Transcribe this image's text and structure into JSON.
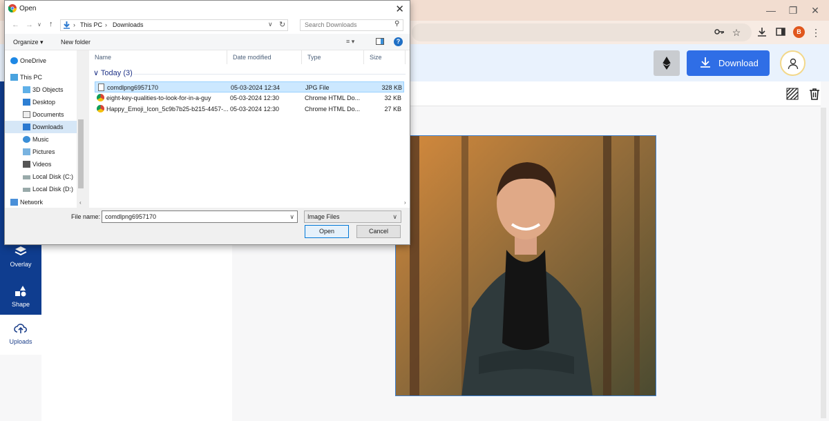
{
  "browser": {
    "profile_initial": "B"
  },
  "header": {
    "download_label": "Download"
  },
  "sidebar": {
    "items": [
      {
        "label": "Overlay",
        "icon": "layers-icon"
      },
      {
        "label": "Shape",
        "icon": "shapes-icon"
      },
      {
        "label": "Uploads",
        "icon": "cloud-upload-icon"
      }
    ]
  },
  "dialog": {
    "title": "Open",
    "breadcrumb": [
      "This PC",
      "Downloads"
    ],
    "search_placeholder": "Search Downloads",
    "organize_label": "Organize ▾",
    "new_folder_label": "New folder",
    "nav_items": [
      {
        "label": "OneDrive",
        "icon": "cloud-icon"
      },
      {
        "label": "This PC",
        "icon": "computer-icon"
      },
      {
        "label": "3D Objects",
        "icon": "cube-icon"
      },
      {
        "label": "Desktop",
        "icon": "desktop-icon"
      },
      {
        "label": "Documents",
        "icon": "document-icon"
      },
      {
        "label": "Downloads",
        "icon": "download-arrow-icon"
      },
      {
        "label": "Music",
        "icon": "music-icon"
      },
      {
        "label": "Pictures",
        "icon": "pictures-icon"
      },
      {
        "label": "Videos",
        "icon": "video-icon"
      },
      {
        "label": "Local Disk (C:)",
        "icon": "drive-icon"
      },
      {
        "label": "Local Disk (D:)",
        "icon": "drive-icon"
      },
      {
        "label": "Network",
        "icon": "network-icon"
      }
    ],
    "columns": [
      "Name",
      "Date modified",
      "Type",
      "Size"
    ],
    "group_label": "Today (3)",
    "files": [
      {
        "name": "comdlpng6957170",
        "date": "05-03-2024 12:34",
        "type": "JPG File",
        "size": "328 KB",
        "icon": "image-file-icon"
      },
      {
        "name": "eight-key-qualities-to-look-for-in-a-guy",
        "date": "05-03-2024 12:30",
        "type": "Chrome HTML Do...",
        "size": "32 KB",
        "icon": "chrome-icon"
      },
      {
        "name": "Happy_Emoji_Icon_5c9b7b25-b215-4457-...",
        "date": "05-03-2024 12:30",
        "type": "Chrome HTML Do...",
        "size": "27 KB",
        "icon": "chrome-icon"
      }
    ],
    "file_name_label": "File name:",
    "file_name_value": "comdlpng6957170",
    "file_type_value": "Image Files",
    "open_label": "Open",
    "cancel_label": "Cancel"
  },
  "colors": {
    "sidebar": "#0f3d8f",
    "accent": "#2f6ee6",
    "selection": "#cce8ff"
  }
}
